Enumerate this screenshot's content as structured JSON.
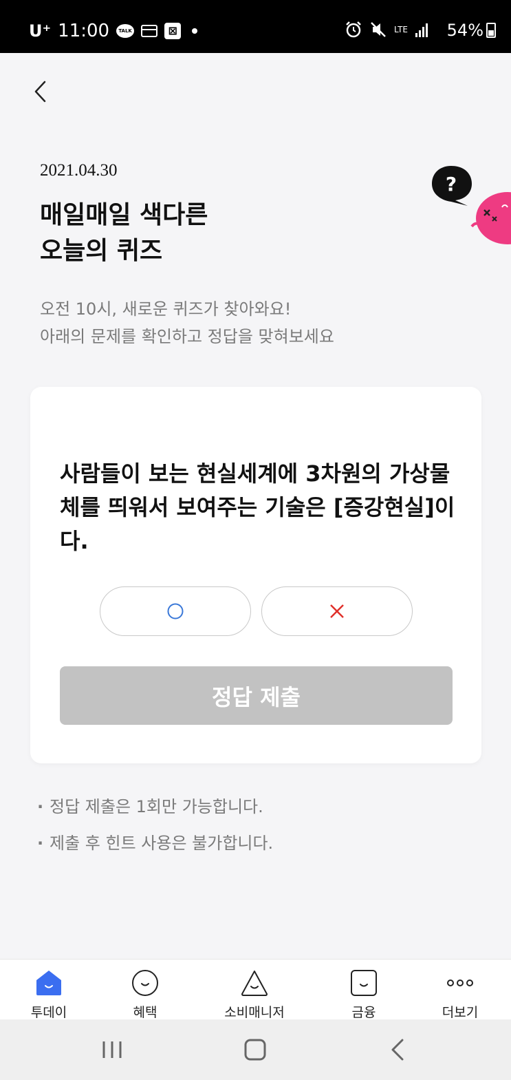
{
  "status_bar": {
    "carrier": "U⁺",
    "time": "11:00",
    "talk_icon_text": "TALK",
    "network": "LTE",
    "battery": "54%"
  },
  "header": {
    "back_icon": "chevron-left-icon"
  },
  "quiz_intro": {
    "date": "2021.04.30",
    "title_line1": "매일매일 색다른",
    "title_line2": "오늘의 퀴즈",
    "subtitle_line1": "오전 10시, 새로운 퀴즈가 찾아와요!",
    "subtitle_line2": "아래의 문제를 확인하고 정답을 맞혀보세요"
  },
  "quiz": {
    "question": "사람들이 보는 현실세계에 3차원의 가상물체를 띄워서 보여주는 기술은 [증강현실]이다.",
    "options": [
      {
        "icon": "circle-o-icon",
        "color": "#3a78d8"
      },
      {
        "icon": "cross-x-icon",
        "color": "#e0302a"
      }
    ],
    "submit_label": "정답 제출",
    "submit_color": "#c2c2c2"
  },
  "notes": [
    "정답 제출은 1회만 가능합니다.",
    "제출 후 힌트 사용은 불가합니다."
  ],
  "bottom_nav": [
    {
      "label": "투데이",
      "icon": "home-smile-icon",
      "active": true,
      "color": "#3b6ef0"
    },
    {
      "label": "혜택",
      "icon": "smile-circle-icon",
      "active": false
    },
    {
      "label": "소비매니저",
      "icon": "triangle-smile-icon",
      "active": false
    },
    {
      "label": "금융",
      "icon": "square-smile-icon",
      "active": false
    },
    {
      "label": "더보기",
      "icon": "more-dots-icon",
      "active": false
    }
  ],
  "android_nav": [
    "recent-apps-icon",
    "home-icon",
    "back-icon"
  ]
}
